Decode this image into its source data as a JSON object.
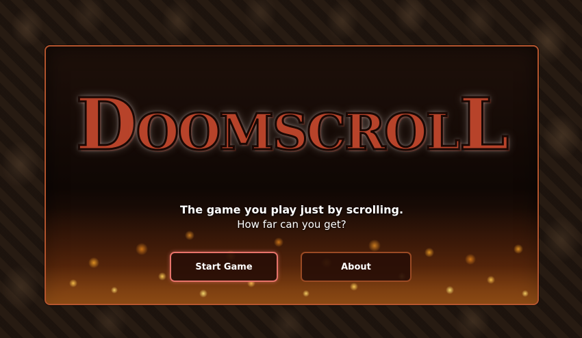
{
  "game": {
    "title": "DoomScroll",
    "logo_parts": [
      "D",
      "OOMSCROL",
      "L"
    ],
    "tagline_line1": "The game you play just by scrolling.",
    "tagline_line2": "How far can you get?"
  },
  "buttons": {
    "start_label": "Start Game",
    "about_label": "About"
  },
  "colors": {
    "logo_red": "#b7432a",
    "panel_border": "#b4552e",
    "start_border": "#e7736a",
    "about_border": "#9a4a24"
  }
}
